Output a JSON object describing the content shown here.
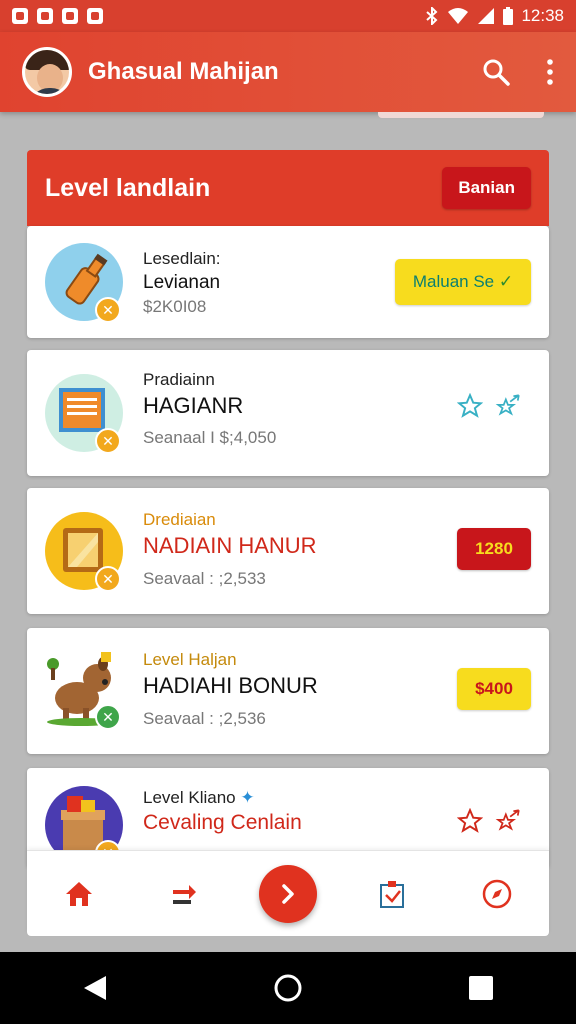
{
  "status_bar": {
    "time": "12:38"
  },
  "app_bar": {
    "title": "Ghasual Mahijan"
  },
  "panel": {
    "title": "Level landlain",
    "header_button": "Banian"
  },
  "items": [
    {
      "label": "Lesedlain:",
      "title": "Levianan",
      "subtitle": "$2K0I08",
      "action": "Maluan Se",
      "thumb_icon": "bottle-icon"
    },
    {
      "label": "Pradiainn",
      "title": "HAGIANR",
      "subtitle": "Seanaal I $;4,050",
      "thumb_icon": "document-icon"
    },
    {
      "label": "Drediaian",
      "title": "NADIAIN HANUR",
      "subtitle": "Seavaal : ;2,533",
      "action": "1280",
      "thumb_icon": "frame-icon"
    },
    {
      "label": "Level Haljan",
      "title": "HADIAHI BONUR",
      "subtitle": "Seavaal : ;2,536",
      "action": "$400",
      "thumb_icon": "dog-icon"
    },
    {
      "label": "Level Kliano",
      "title": "Cevaling Cenlain",
      "subtitle": "",
      "thumb_icon": "gift-box-icon"
    }
  ],
  "colors": {
    "primary": "#df3d29",
    "accent_yellow": "#f7dc1e",
    "accent_red": "#c8161b",
    "star_teal": "#38b0c4"
  }
}
